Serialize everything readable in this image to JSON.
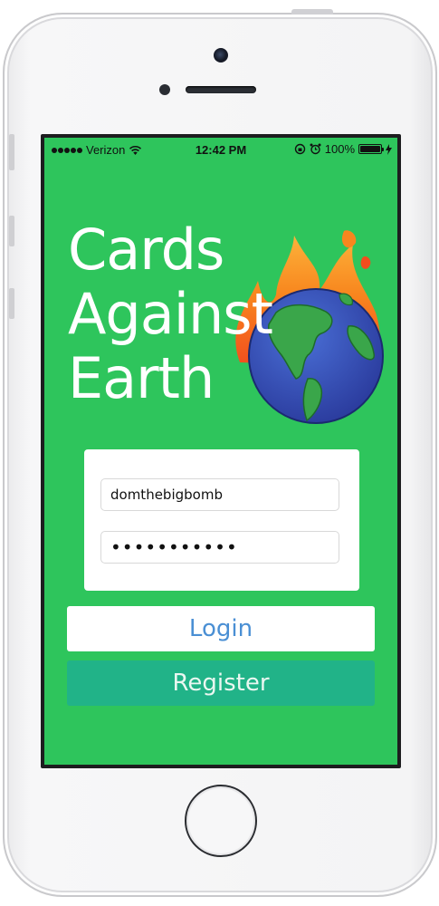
{
  "status_bar": {
    "carrier": "Verizon",
    "time": "12:42 PM",
    "battery_percent": "100%",
    "battery_level": 1.0
  },
  "app": {
    "title_lines": [
      "Cards",
      "Against",
      "Earth"
    ],
    "logo_icon": "flaming-globe-icon"
  },
  "login_form": {
    "username_value": "domthebigbomb",
    "password_value": "•••••••••••",
    "login_label": "Login",
    "register_label": "Register"
  },
  "colors": {
    "background": "#2ec55c",
    "login_text": "#4a8fd4",
    "register_button": "#21b388"
  }
}
